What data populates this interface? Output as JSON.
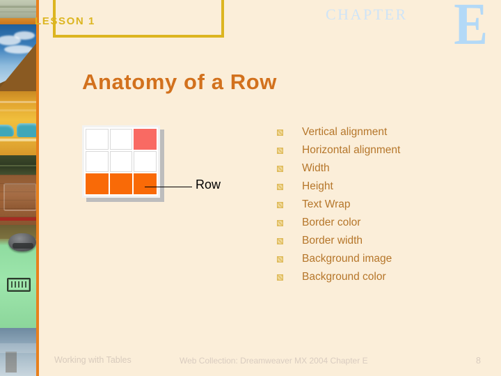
{
  "slide": {
    "background_color": "#fbeed9",
    "lesson_label": "LESSON 1",
    "chapter_word": "CHAPTER",
    "chapter_letter": "E",
    "title": "Anatomy of a Row"
  },
  "figure": {
    "row_label": "Row",
    "accent_color": "#f96a63",
    "row_color": "#f96a07",
    "cells": [
      {
        "style": "plain"
      },
      {
        "style": "plain"
      },
      {
        "style": "accent"
      },
      {
        "style": "plain"
      },
      {
        "style": "plain"
      },
      {
        "style": "plain"
      },
      {
        "style": "row"
      },
      {
        "style": "row"
      },
      {
        "style": "row"
      }
    ]
  },
  "bullets": [
    {
      "label": "Vertical alignment"
    },
    {
      "label": "Horizontal alignment"
    },
    {
      "label": "Width"
    },
    {
      "label": "Height"
    },
    {
      "label": "Text Wrap"
    },
    {
      "label": "Border color"
    },
    {
      "label": "Border width"
    },
    {
      "label": "Background image"
    },
    {
      "label": "Background color"
    }
  ],
  "footer": {
    "left": "Working with Tables",
    "center": "Web Collection: Dreamweaver MX 2004 Chapter E",
    "page": "8"
  },
  "colors": {
    "title": "#d2711d",
    "bullet_text": "#b5762a",
    "lesson_gold": "#dcb520",
    "strip_rule": "#e8801c"
  }
}
